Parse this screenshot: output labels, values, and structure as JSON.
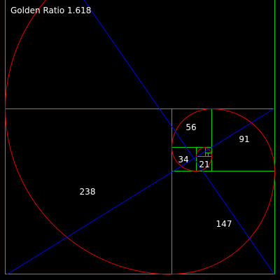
{
  "title": "Golden Ratio 1.618",
  "colors": {
    "background": "#000000",
    "squares": "#00d000",
    "spiral": "#e00000",
    "diagonals": "#0000e0",
    "labels": "#ffffff"
  },
  "squares": [
    {
      "label": "238"
    },
    {
      "label": "147"
    },
    {
      "label": "91"
    },
    {
      "label": "56"
    },
    {
      "label": "34"
    },
    {
      "label": "21"
    }
  ]
}
